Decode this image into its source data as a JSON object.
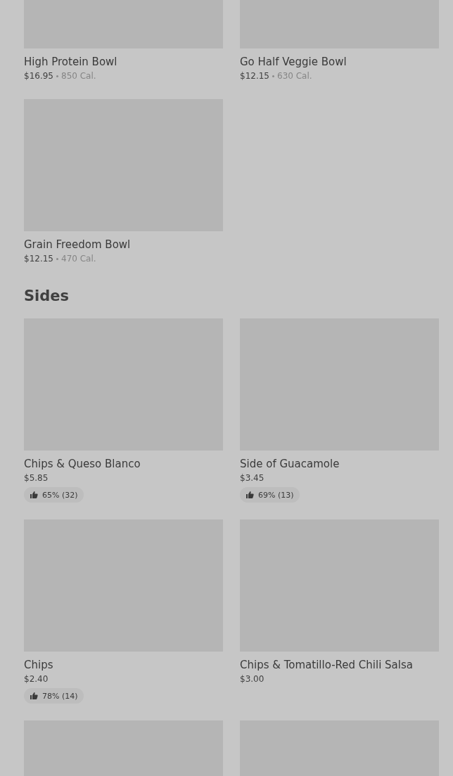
{
  "sections": [
    {
      "items": [
        {
          "image": {
            "kind": "picture"
          },
          "name": "High Protein Bowl",
          "price": "$16.95",
          "calories": "850 Cal."
        },
        {
          "image": {
            "kind": "picture"
          },
          "name": "Go Half Veggie Bowl",
          "price": "$12.15",
          "calories": "630 Cal."
        },
        {
          "image": {
            "kind": "picture"
          },
          "name": "Grain Freedom Bowl",
          "price": "$12.15",
          "calories": "470 Cal."
        }
      ]
    },
    {
      "title": "Sides",
      "items": [
        {
          "image": {
            "kind": "picture"
          },
          "name": "Chips & Queso Blanco",
          "price": "$5.85",
          "rating": "65% (32)"
        },
        {
          "image": {
            "kind": "picture"
          },
          "name": "Side of Guacamole",
          "price": "$3.45",
          "rating": "69% (13)"
        },
        {
          "image": {
            "kind": "picture"
          },
          "name": "Chips",
          "price": "$2.40",
          "rating": "78% (14)"
        },
        {
          "image": {
            "kind": "picture"
          },
          "name": "Chips & Tomatillo-Red Chili Salsa",
          "price": "$3.00"
        },
        {
          "image": {
            "kind": "picture"
          }
        },
        {
          "image": {
            "kind": "picture"
          }
        }
      ]
    }
  ]
}
